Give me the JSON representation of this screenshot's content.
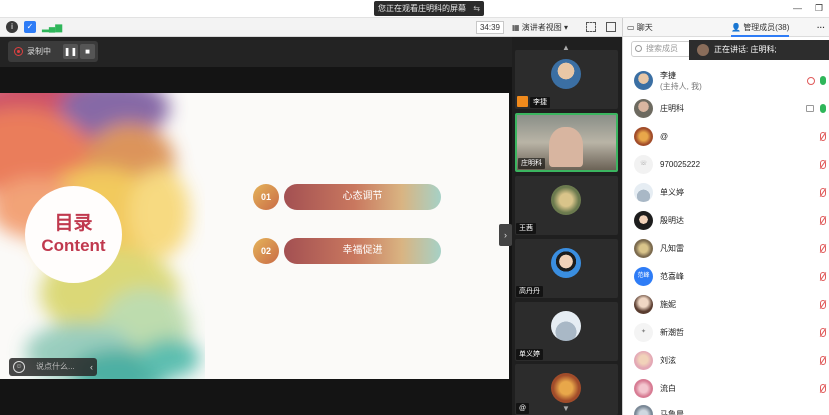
{
  "share_banner": {
    "text": "您正在观看庄明科的屏幕",
    "exit_icon": "exit-fullscreen-icon"
  },
  "toolbar": {
    "timer": "34:39",
    "view_label": "演讲者视图",
    "icons": [
      "info-icon",
      "shield-icon",
      "signal-icon",
      "layout-icon",
      "fullscreen-icon",
      "sidebar-icon"
    ]
  },
  "right_header": {
    "chat_tab": "聊天",
    "members_tab": "管理成员(38)",
    "more": "···"
  },
  "recording": {
    "label": "录制中",
    "pause": "❚❚",
    "stop": "■"
  },
  "slide": {
    "title_cn": "目录",
    "title_en": "Content",
    "items": [
      {
        "num": "01",
        "label": "心态调节"
      },
      {
        "num": "02",
        "label": "幸福促进"
      }
    ]
  },
  "chat_input": {
    "placeholder": "说点什么...",
    "expand": "‹"
  },
  "video_strip": {
    "tiles": [
      {
        "name": "李捷"
      },
      {
        "name": "庄明科"
      },
      {
        "name": "王茜"
      },
      {
        "name": "高丹丹"
      },
      {
        "name": "单义婷"
      },
      {
        "name": "@"
      }
    ],
    "up_arrow": "▲",
    "down_arrow": "▼"
  },
  "participants": {
    "search_placeholder": "搜索成员",
    "speaking": "正在讲话: 庄明科;",
    "list": [
      {
        "name": "李捷",
        "role": "(主持人, 我)"
      },
      {
        "name": "庄明科",
        "role": ""
      },
      {
        "name": "@",
        "role": ""
      },
      {
        "name": "970025222",
        "role": ""
      },
      {
        "name": "单义婷",
        "role": ""
      },
      {
        "name": "殷明达",
        "role": ""
      },
      {
        "name": "凡知雷",
        "role": ""
      },
      {
        "name": "范喜峰",
        "role": "",
        "avatar_text": "范峰"
      },
      {
        "name": "施妮",
        "role": ""
      },
      {
        "name": "新潮哲",
        "role": ""
      },
      {
        "name": "刘泫",
        "role": ""
      },
      {
        "name": "流白",
        "role": ""
      },
      {
        "name": "马鲁晨",
        "role": ""
      }
    ]
  },
  "colors": {
    "accent": "#2e7cf6",
    "title_red": "#c0394e",
    "active_green": "#3bb560",
    "mute_red": "#e05a5a"
  }
}
